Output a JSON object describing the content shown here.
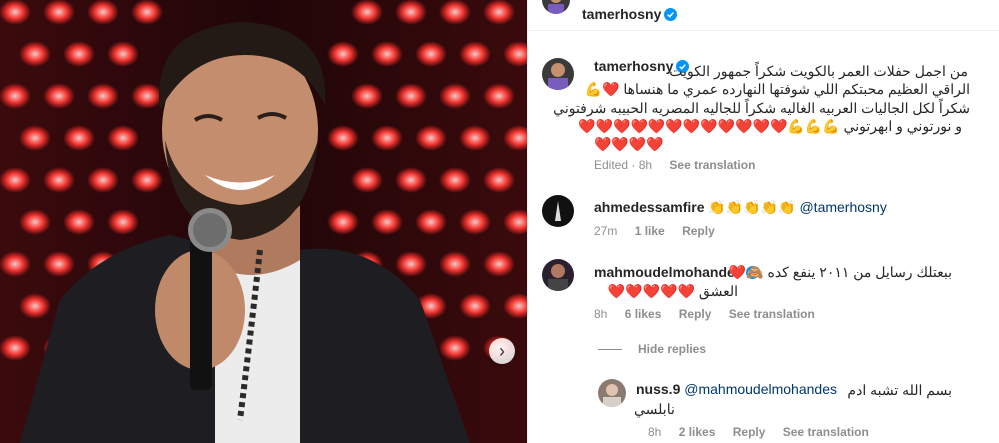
{
  "header": {
    "username": "tamerhosny"
  },
  "caption": {
    "username": "tamerhosny",
    "line1": "من اجمل حفلات العمر بالكويت شكراً جمهور الكويت",
    "line2": "الراقي العظيم محبتكم اللي شوفتها النهارده عمري ما هنساها ❤️💪",
    "line3": "شكراً لكل الجاليات العربيه الغاليه شكراً للجاليه المصريه الحبيبه شرفتوني",
    "line4": "و نورتوني و ابهرتوني 💪💪💪❤️❤️❤️❤️❤️❤️❤️❤️❤️❤️❤️❤️",
    "line5": "❤️❤️❤️❤️",
    "time": "Edited · 8h",
    "see_translation": "See translation"
  },
  "comments": [
    {
      "username": "ahmedessamfire",
      "text": "👏👏👏👏👏",
      "mention": "@tamerhosny",
      "time": "27m",
      "likes": "1 like",
      "reply": "Reply"
    },
    {
      "username": "mahmoudelmohandes",
      "line1": "ببعتلك رسايل من ٢٠١١ ينفع كده 🙈❤️",
      "line2": "العشق ❤️❤️❤️❤️❤️",
      "time": "8h",
      "likes": "6 likes",
      "reply": "Reply",
      "see_translation": "See translation"
    }
  ],
  "hide_replies": "Hide replies",
  "reply_comment": {
    "username": "nuss.9",
    "mention": "@mahmoudelmohandes",
    "line1": "بسم الله تشبه ادم",
    "line2": "نابلسي",
    "time": "8h",
    "likes": "2 likes",
    "reply": "Reply",
    "see_translation": "See translation"
  },
  "icons": {
    "verified": "verified-badge-icon",
    "next": "chevron-right-icon"
  },
  "colors": {
    "verified": "#0095f6",
    "heart": "#e0112b",
    "meta": "#8e8e8e",
    "mention": "#00376b"
  }
}
